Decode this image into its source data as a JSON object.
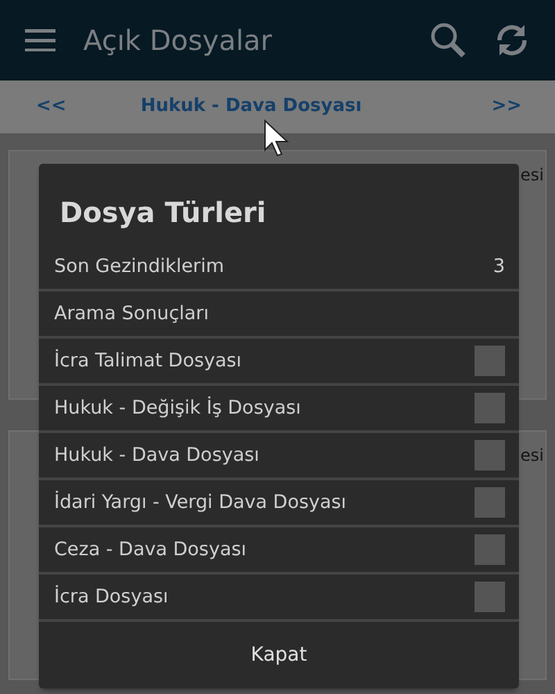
{
  "app_bar": {
    "title": "Açık Dosyalar"
  },
  "pager": {
    "prev": "<<",
    "title": "Hukuk - Dava Dosyası",
    "next": ">>"
  },
  "background_fragments": [
    "esi",
    "esi"
  ],
  "dialog": {
    "title": "Dosya Türleri",
    "items": [
      {
        "label": "Son Gezindiklerim",
        "kind": "count",
        "count": "3"
      },
      {
        "label": "Arama Sonuçları",
        "kind": "plain"
      },
      {
        "label": "İcra Talimat Dosyası",
        "kind": "redacted"
      },
      {
        "label": "Hukuk - Değişik İş Dosyası",
        "kind": "redacted"
      },
      {
        "label": "Hukuk - Dava Dosyası",
        "kind": "redacted"
      },
      {
        "label": "İdari Yargı - Vergi Dava Dosyası",
        "kind": "redacted"
      },
      {
        "label": "Ceza - Dava Dosyası",
        "kind": "redacted"
      },
      {
        "label": "İcra Dosyası",
        "kind": "redacted"
      }
    ],
    "close_button": "Kapat"
  }
}
